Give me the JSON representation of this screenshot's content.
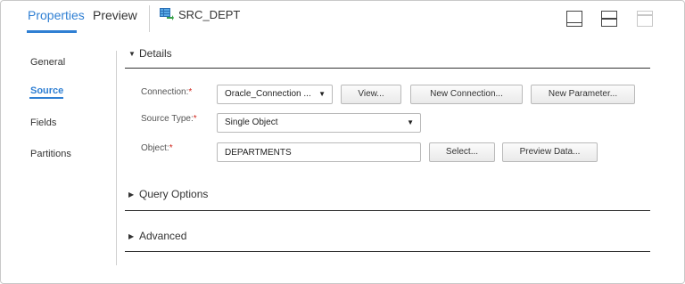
{
  "tabs": {
    "properties": "Properties",
    "preview": "Preview",
    "source_name": "SRC_DEPT"
  },
  "nav": {
    "general": "General",
    "source": "Source",
    "fields": "Fields",
    "partitions": "Partitions"
  },
  "details": {
    "title": "Details",
    "connection_label": "Connection:",
    "connection_value": "Oracle_Connection ...",
    "view_button": "View...",
    "new_connection_button": "New Connection...",
    "new_parameter_button": "New Parameter...",
    "source_type_label": "Source Type:",
    "source_type_value": "Single Object",
    "object_label": "Object:",
    "object_value": "DEPARTMENTS",
    "select_button": "Select...",
    "preview_data_button": "Preview Data...",
    "required_mark": "*"
  },
  "sections": {
    "query_options": "Query Options",
    "advanced": "Advanced"
  },
  "colors": {
    "accent": "#2f7fd3",
    "required": "#d0271d"
  }
}
